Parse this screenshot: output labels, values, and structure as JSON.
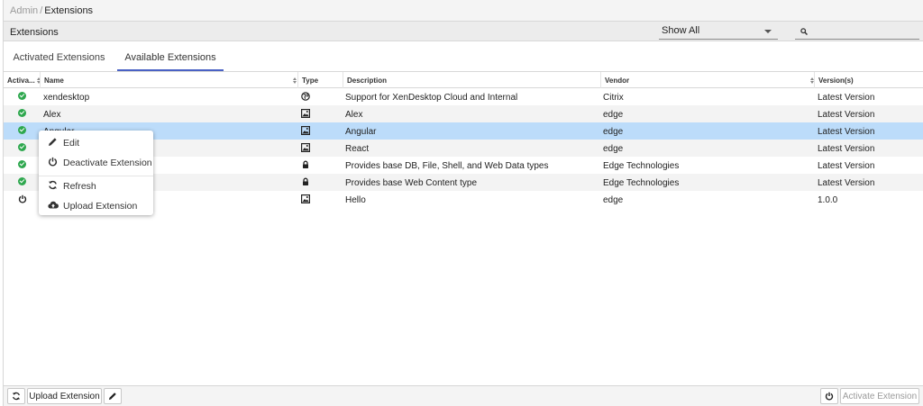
{
  "breadcrumb": {
    "root": "Admin",
    "separator": "/",
    "current": "Extensions"
  },
  "titlebar": {
    "title": "Extensions",
    "filter": {
      "selected": "Show All"
    },
    "search": {
      "value": "",
      "placeholder": ""
    }
  },
  "tabs": [
    {
      "label": "Activated Extensions",
      "active": false
    },
    {
      "label": "Available Extensions",
      "active": true
    }
  ],
  "grid": {
    "columns": [
      "Activa...",
      "Name",
      "Type",
      "Description",
      "Vendor",
      "Version(s)"
    ],
    "rows": [
      {
        "activated": true,
        "name": "xendesktop",
        "type": "globe-icon",
        "description": "Support for XenDesktop Cloud and Internal",
        "vendor": "Citrix",
        "version": "Latest Version",
        "selected": false
      },
      {
        "activated": true,
        "name": "Alex",
        "type": "image-icon",
        "description": "Alex",
        "vendor": "edge",
        "version": "Latest Version",
        "selected": false
      },
      {
        "activated": true,
        "name": "Angular",
        "type": "image-icon",
        "description": "Angular",
        "vendor": "edge",
        "version": "Latest Version",
        "selected": true
      },
      {
        "activated": true,
        "name": "React",
        "type": "image-icon",
        "description": "React",
        "vendor": "edge",
        "version": "Latest Version",
        "selected": false
      },
      {
        "activated": true,
        "name": "",
        "type": "lock-icon",
        "description": "Provides base DB, File, Shell, and Web Data types",
        "vendor": "Edge Technologies",
        "version": "Latest Version",
        "selected": false
      },
      {
        "activated": true,
        "name": "",
        "type": "lock-icon",
        "description": "Provides base Web Content type",
        "vendor": "Edge Technologies",
        "version": "Latest Version",
        "selected": false
      },
      {
        "activated": false,
        "name": "",
        "type": "image-icon",
        "description": "Hello",
        "vendor": "edge",
        "version": "1.0.0",
        "selected": false
      }
    ]
  },
  "context_menu": {
    "items": [
      {
        "label": "Edit",
        "icon": "pencil-icon"
      },
      {
        "label": "Deactivate Extension",
        "icon": "power-icon"
      },
      {
        "label": "Refresh",
        "icon": "refresh-icon"
      },
      {
        "label": "Upload Extension",
        "icon": "cloud-upload-icon"
      }
    ]
  },
  "footer": {
    "upload_label": "Upload Extension",
    "activate_label": "Activate Extension"
  },
  "colors": {
    "selected_row": "#bcdcfa",
    "active_tab_underline": "#4a62c4",
    "activated_check": "#2fa84f"
  }
}
